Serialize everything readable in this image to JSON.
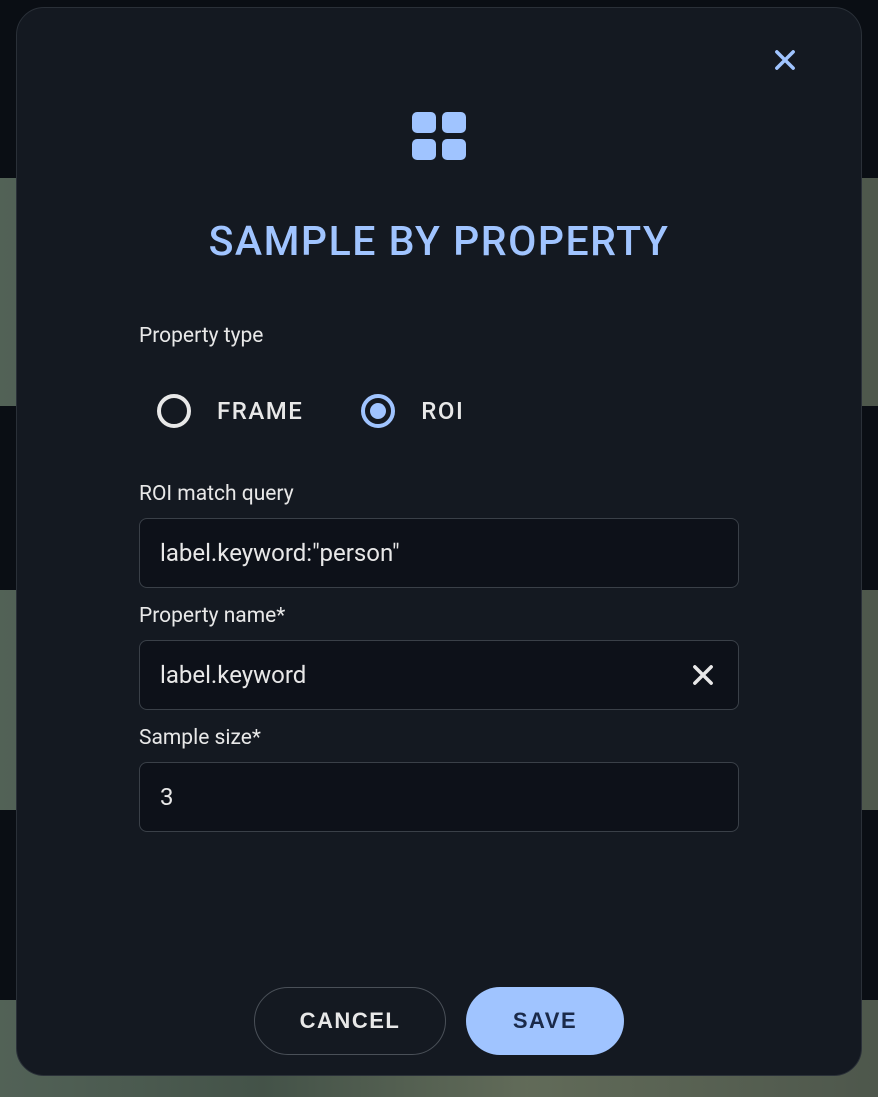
{
  "title": "SAMPLE BY PROPERTY",
  "property_type": {
    "label": "Property type",
    "options": {
      "frame": "FRAME",
      "roi": "ROI"
    },
    "selected": "roi"
  },
  "fields": {
    "roi_match_query": {
      "label": "ROI match query",
      "value": "label.keyword:\"person\""
    },
    "property_name": {
      "label": "Property name*",
      "value": "label.keyword"
    },
    "sample_size": {
      "label": "Sample size*",
      "value": "3"
    }
  },
  "actions": {
    "cancel": "CANCEL",
    "save": "SAVE"
  }
}
